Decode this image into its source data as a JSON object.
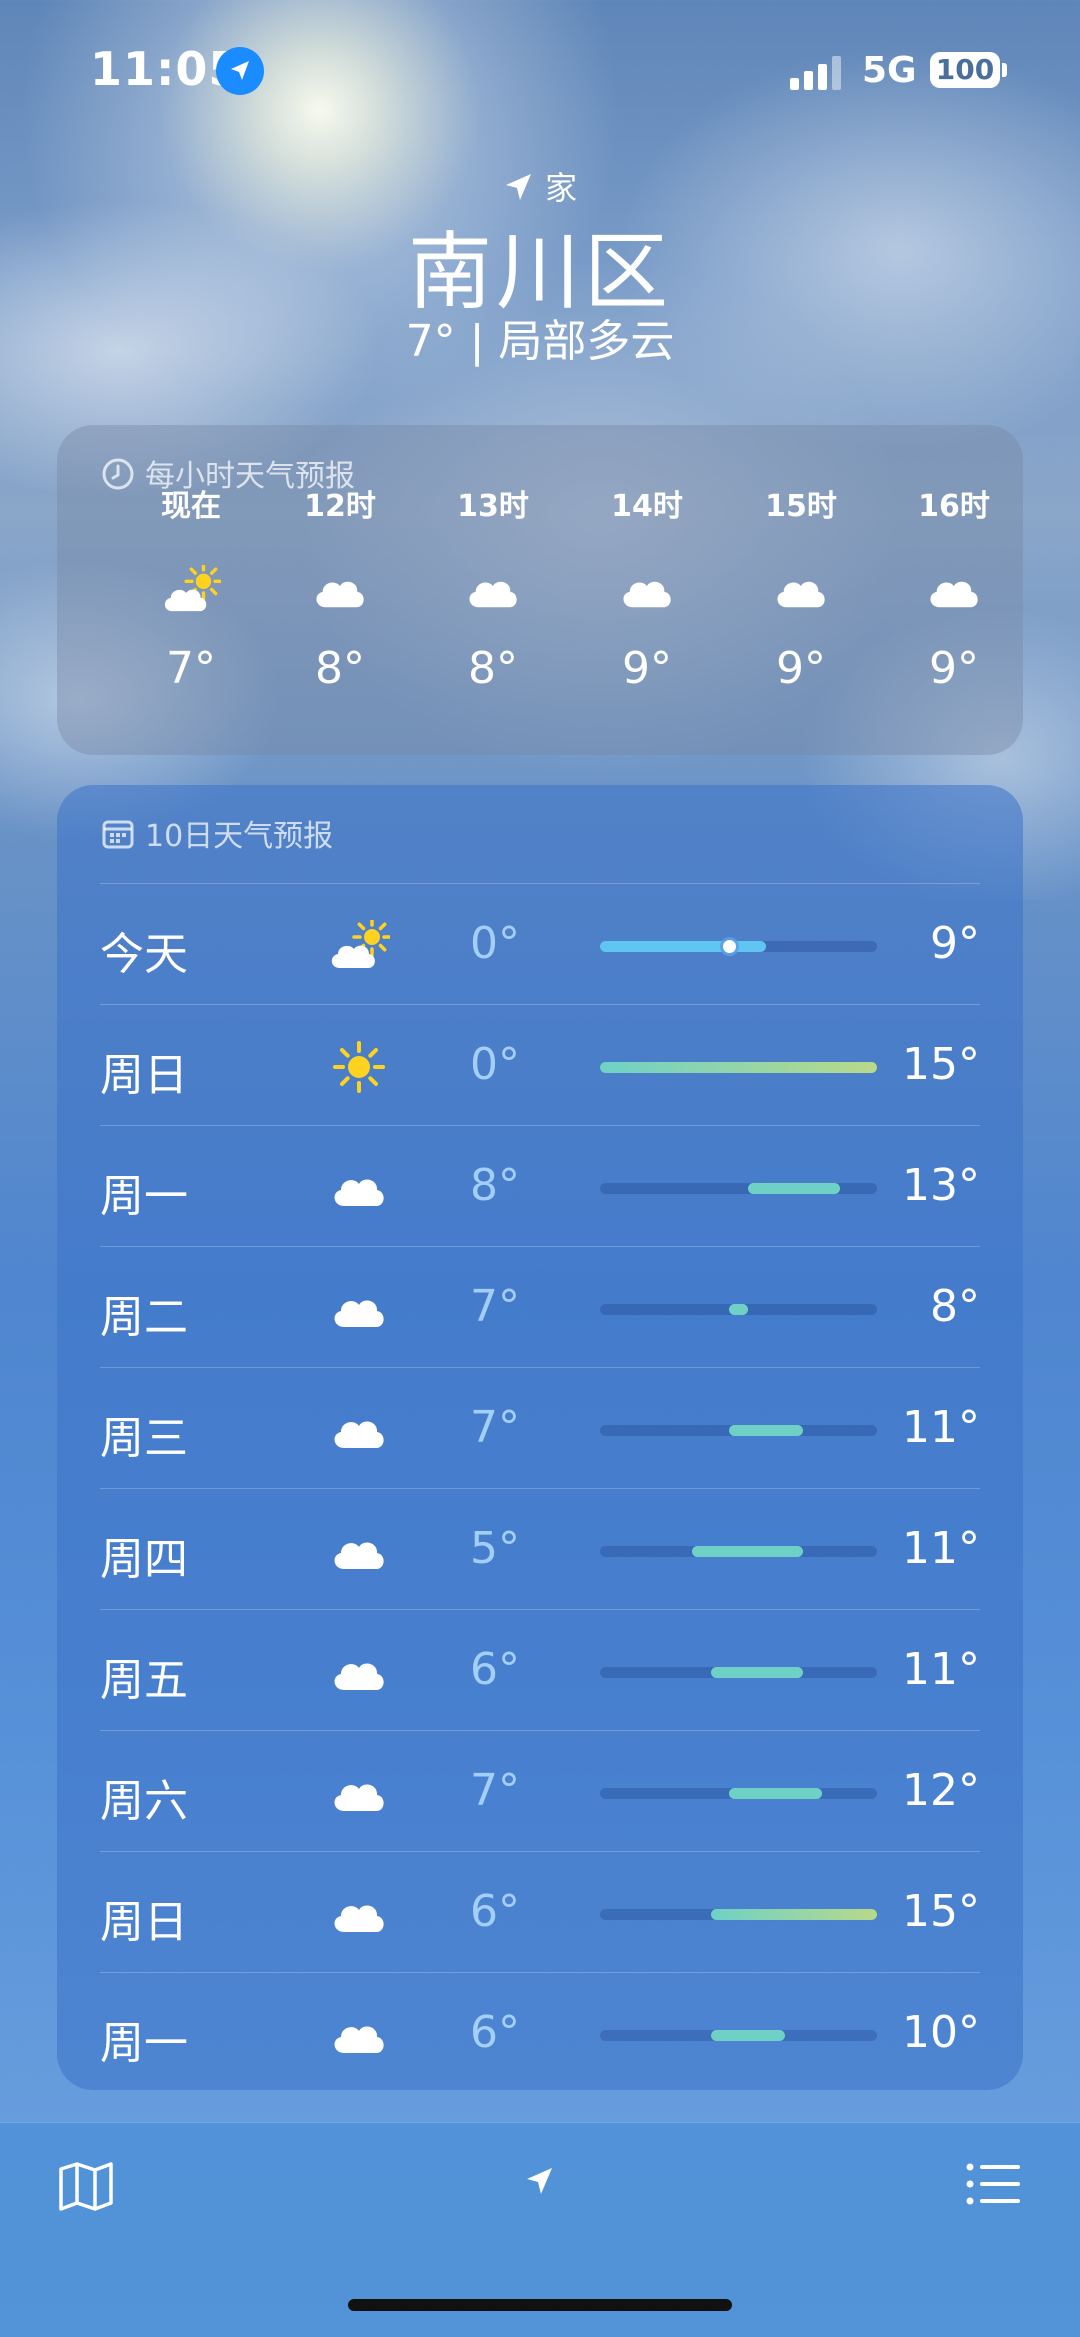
{
  "status_bar": {
    "time": "11:05",
    "network": "5G",
    "battery": "100",
    "location_icon": "location-arrow-icon"
  },
  "header": {
    "home_label": "家",
    "city": "南川区",
    "condition": "7° | 局部多云"
  },
  "hourly": {
    "title": "每小时天气预报",
    "items": [
      {
        "label": "现在",
        "icon": "sun-cloud-icon",
        "temp": "7°"
      },
      {
        "label": "12时",
        "icon": "cloud-icon",
        "temp": "8°"
      },
      {
        "label": "13时",
        "icon": "cloud-icon",
        "temp": "8°"
      },
      {
        "label": "14时",
        "icon": "cloud-icon",
        "temp": "9°"
      },
      {
        "label": "15时",
        "icon": "cloud-icon",
        "temp": "9°"
      },
      {
        "label": "16时",
        "icon": "cloud-icon",
        "temp": "9°"
      }
    ]
  },
  "daily": {
    "title": "10日天气预报",
    "range": {
      "min": 0,
      "max": 15
    },
    "current_temp": 7,
    "items": [
      {
        "day": "今天",
        "icon": "sun-cloud-icon",
        "low": "0°",
        "high": "9°",
        "low_v": 0,
        "high_v": 9
      },
      {
        "day": "周日",
        "icon": "sun-icon",
        "low": "0°",
        "high": "15°",
        "low_v": 0,
        "high_v": 15
      },
      {
        "day": "周一",
        "icon": "cloud-icon",
        "low": "8°",
        "high": "13°",
        "low_v": 8,
        "high_v": 13
      },
      {
        "day": "周二",
        "icon": "cloud-icon",
        "low": "7°",
        "high": "8°",
        "low_v": 7,
        "high_v": 8
      },
      {
        "day": "周三",
        "icon": "cloud-icon",
        "low": "7°",
        "high": "11°",
        "low_v": 7,
        "high_v": 11
      },
      {
        "day": "周四",
        "icon": "cloud-icon",
        "low": "5°",
        "high": "11°",
        "low_v": 5,
        "high_v": 11
      },
      {
        "day": "周五",
        "icon": "cloud-icon",
        "low": "6°",
        "high": "11°",
        "low_v": 6,
        "high_v": 11
      },
      {
        "day": "周六",
        "icon": "cloud-icon",
        "low": "7°",
        "high": "12°",
        "low_v": 7,
        "high_v": 12
      },
      {
        "day": "周日",
        "icon": "cloud-icon",
        "low": "6°",
        "high": "15°",
        "low_v": 6,
        "high_v": 15
      },
      {
        "day": "周一",
        "icon": "cloud-icon",
        "low": "6°",
        "high": "10°",
        "low_v": 6,
        "high_v": 10
      }
    ]
  },
  "toolbar": {
    "map": "map-icon",
    "location": "location-arrow-icon",
    "list": "list-icon"
  },
  "colors": {
    "bar_cool": "#5ec6f0",
    "bar_mild": "#6fd1c6",
    "bar_warm": "#b8d98a",
    "location_badge": "#1a8cff",
    "sun": "#ffd21f"
  }
}
